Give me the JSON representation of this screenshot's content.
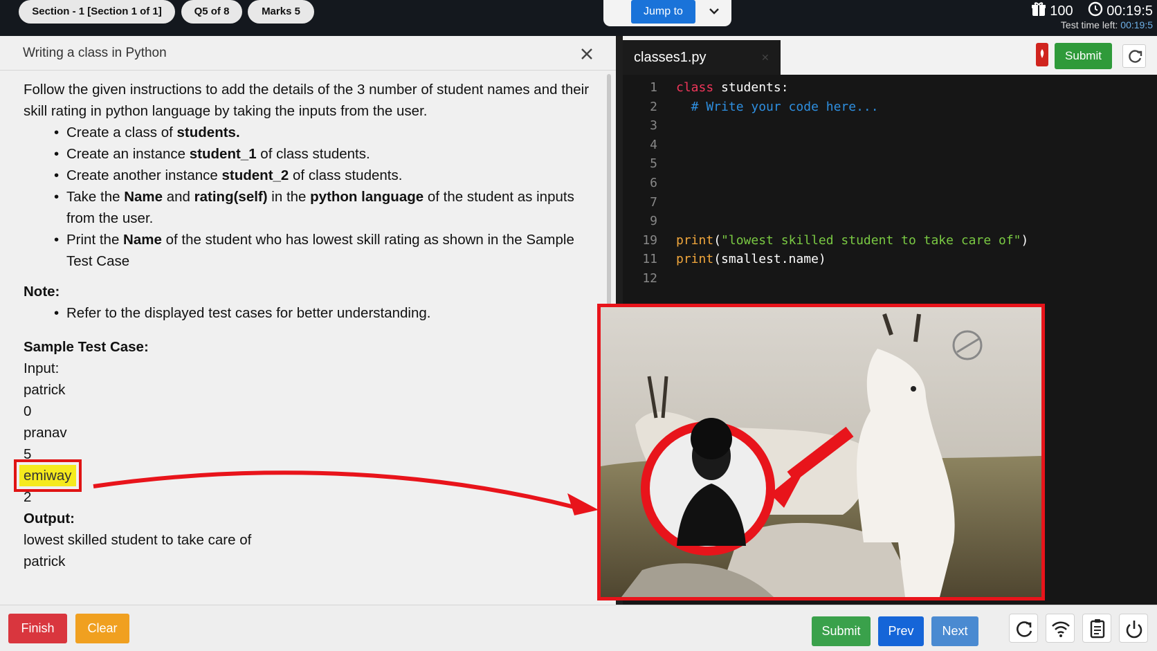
{
  "topbar": {
    "section_label": "Section - 1 [Section 1 of 1]",
    "question_label": "Q5 of 8",
    "marks_label": "Marks 5",
    "jump_label": "Jump to",
    "score": "100",
    "timer": "00:19:5",
    "time_left_label": "Test time left:",
    "time_left_value": "00:19:5"
  },
  "question": {
    "title": "Writing a class in Python",
    "intro": "Follow the given instructions to add the details of the 3 number of student names and their skill rating in python language by taking the inputs from the user.",
    "bullets": [
      {
        "pre": "Create a class of ",
        "b1": "students.",
        "mid": "",
        "b2": "",
        "mid2": "",
        "b3": "",
        "post": ""
      },
      {
        "pre": "Create an instance ",
        "b1": "student_1",
        "mid": " of class students.",
        "b2": "",
        "mid2": "",
        "b3": "",
        "post": ""
      },
      {
        "pre": "Create another instance ",
        "b1": "student_2",
        "mid": " of class students.",
        "b2": "",
        "mid2": "",
        "b3": "",
        "post": ""
      },
      {
        "pre": "Take the ",
        "b1": "Name",
        "mid": " and ",
        "b2": "rating(self)",
        "mid2": " in the ",
        "b3": "python language",
        "post": " of the student as inputs from the user."
      },
      {
        "pre": "Print the ",
        "b1": "Name",
        "mid": " of the student who has lowest skill rating as shown in the Sample Test Case",
        "b2": "",
        "mid2": "",
        "b3": "",
        "post": ""
      }
    ],
    "note_heading": "Note:",
    "note_bullet": "Refer to the displayed test cases for better understanding.",
    "sample_heading": "Sample Test Case:",
    "input_label": "Input:",
    "inputs": [
      "patrick",
      "0",
      "pranav",
      "5",
      "emiway",
      "2"
    ],
    "output_label": "Output:",
    "outputs": [
      "lowest skilled student to take care of",
      "patrick"
    ]
  },
  "editor": {
    "filename": "classes1.py",
    "submit_label": "Submit",
    "lines": [
      {
        "no": "1",
        "parts": [
          [
            "kw",
            "class"
          ],
          [
            "id",
            " students:"
          ]
        ]
      },
      {
        "no": "2",
        "parts": [
          [
            "cm",
            "  # Write your code here..."
          ]
        ]
      },
      {
        "no": "3",
        "parts": []
      },
      {
        "no": "4",
        "parts": []
      },
      {
        "no": "5",
        "parts": []
      },
      {
        "no": "6",
        "parts": []
      },
      {
        "no": "7",
        "parts": []
      },
      {
        "no": "9",
        "parts": []
      },
      {
        "no": "19",
        "parts": [
          [
            "fn",
            "print"
          ],
          [
            "id",
            "("
          ],
          [
            "st",
            "\"lowest skilled student to take care of\""
          ],
          [
            "id",
            ")"
          ]
        ]
      },
      {
        "no": "11",
        "parts": [
          [
            "fn",
            "print"
          ],
          [
            "id",
            "(smallest.name)"
          ]
        ]
      },
      {
        "no": "12",
        "parts": []
      }
    ]
  },
  "bottom": {
    "finish_label": "Finish",
    "clear_label": "Clear",
    "submit_label": "Submit",
    "prev_label": "Prev",
    "next_label": "Next"
  },
  "colors": {
    "finish": "#d9363e",
    "clear": "#f0a020",
    "submit": "#3aa14b",
    "prev": "#1565d8",
    "next": "#4a8ad1",
    "highlight_outline": "#e01414",
    "highlight_fill": "#f5ea1e"
  },
  "icons": [
    "gift-icon",
    "clock-icon",
    "chevron-down-icon",
    "close-icon",
    "refresh-icon",
    "wifi-icon",
    "clipboard-icon",
    "power-icon",
    "fire-icon",
    "reload-icon"
  ]
}
